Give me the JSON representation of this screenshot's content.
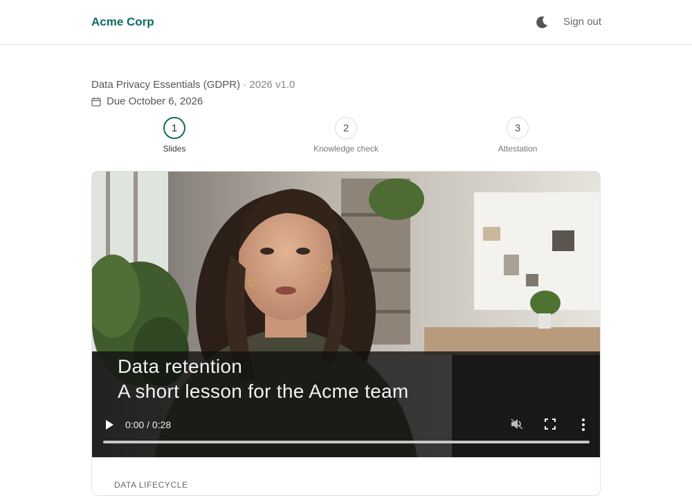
{
  "header": {
    "brand": "Acme Corp",
    "theme_icon": "moon-icon",
    "sign_out_label": "Sign out"
  },
  "course": {
    "title": "Data Privacy Essentials (GDPR)",
    "separator": " · ",
    "version": "2026 v1.0",
    "due_icon": "calendar-icon",
    "due": "Due October 6, 2026"
  },
  "steps": [
    {
      "number": "1",
      "label": "Slides",
      "active": true
    },
    {
      "number": "2",
      "label": "Knowledge check",
      "active": false
    },
    {
      "number": "3",
      "label": "Attestation",
      "active": false
    }
  ],
  "video": {
    "caption_title": "Data retention",
    "caption_subtitle": "A short lesson for the Acme team",
    "time": "0:00 / 0:28",
    "progress": 0,
    "icons": [
      "play-icon",
      "volume-muted-icon",
      "fullscreen-icon",
      "more-vertical-icon"
    ]
  },
  "section": {
    "label": "DATA LIFECYCLE"
  },
  "colors": {
    "accent": "#0d6b62"
  }
}
